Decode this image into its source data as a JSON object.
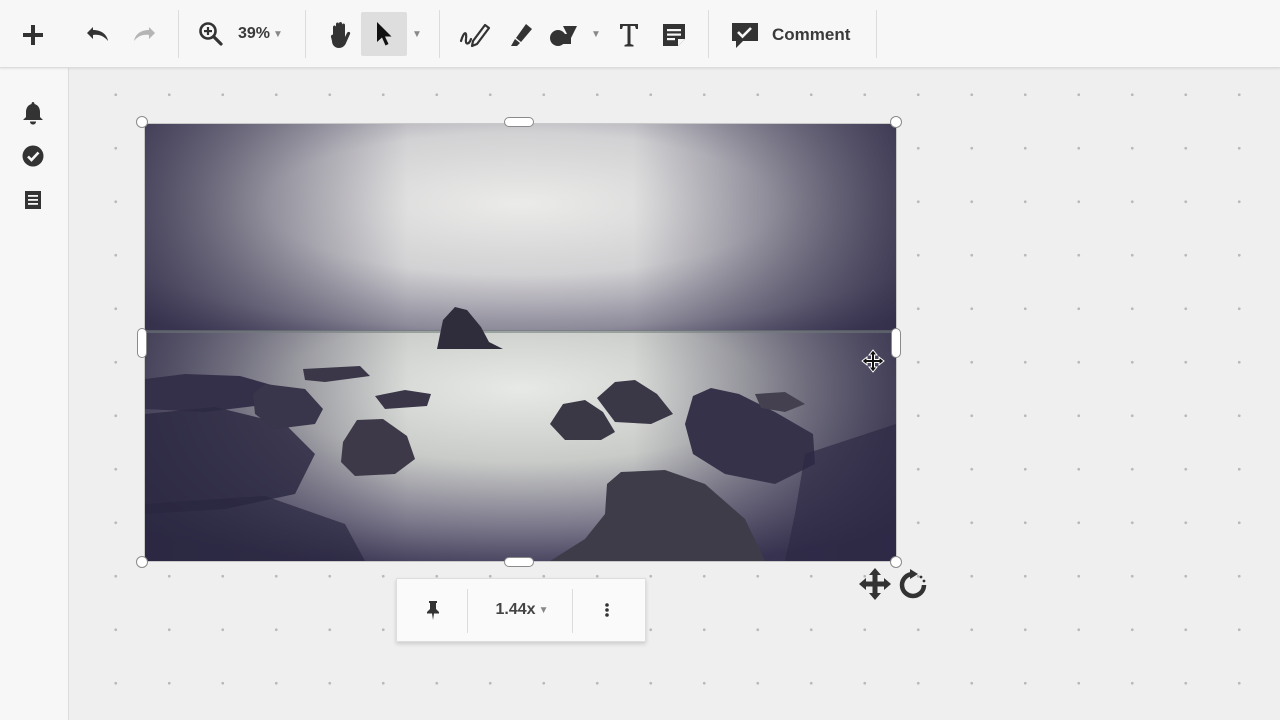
{
  "toolbar": {
    "zoom_value": "39%",
    "comment_label": "Comment"
  },
  "image_toolbar": {
    "scale_value": "1.44x"
  },
  "icons": {
    "add": "plus-icon",
    "undo": "undo-icon",
    "redo": "redo-icon",
    "zoom": "zoom-in-icon",
    "hand": "hand-icon",
    "select": "cursor-arrow-icon",
    "pen": "pen-icon",
    "marker": "marker-icon",
    "shapes": "shapes-icon",
    "text": "text-icon",
    "note": "note-icon",
    "comment": "comment-icon",
    "notifications": "bell-icon",
    "tasks": "check-circle-icon",
    "list": "list-icon",
    "pin": "pin-icon",
    "more": "more-vertical-icon",
    "move": "move-icon",
    "rotate": "rotate-icon"
  },
  "colors": {
    "toolbar_bg": "#f7f7f7",
    "canvas_bg": "#efefef",
    "icon": "#3a3a3a",
    "active_tool_bg": "#dedede"
  }
}
